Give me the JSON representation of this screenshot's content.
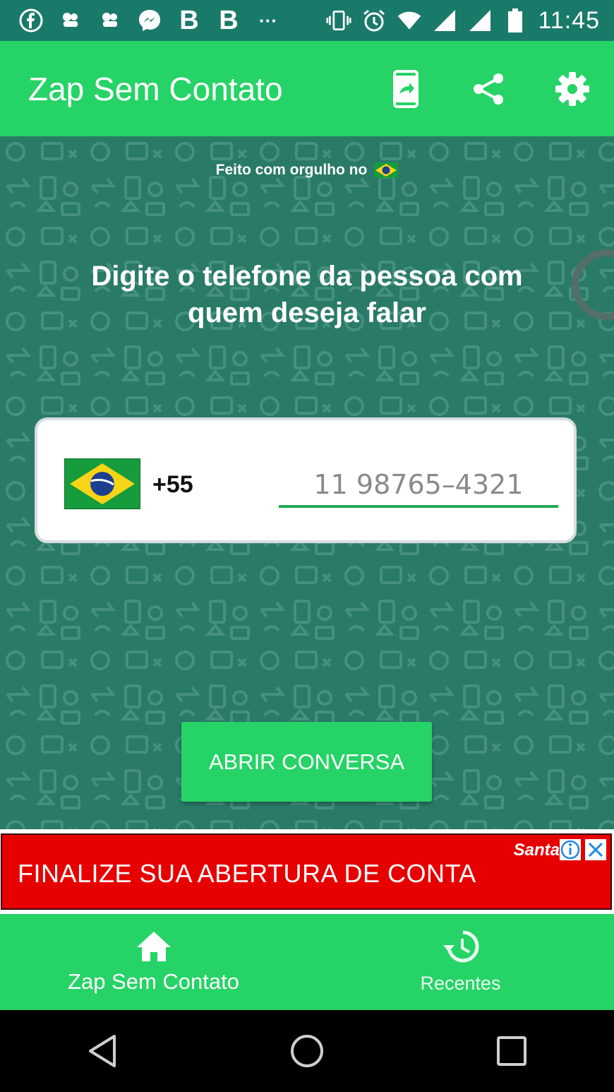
{
  "status_bar": {
    "time": "11:45",
    "icons": [
      "facebook-icon",
      "game-icon",
      "game-icon",
      "messenger-icon",
      "b-icon",
      "b-icon",
      "more-icon",
      "vibrate-icon",
      "alarm-icon",
      "wifi-icon",
      "signal-icon",
      "signal-icon",
      "battery-icon"
    ],
    "b_label": "B",
    "more_label": "···"
  },
  "app_bar": {
    "title": "Zap Sem Contato",
    "actions": [
      "open-in-app-icon",
      "share-icon",
      "settings-icon"
    ]
  },
  "main": {
    "tagline": "Feito com orgulho no",
    "headline": "Digite o telefone da pessoa com quem deseja falar",
    "country_code": "+55",
    "phone_placeholder": "11 98765–4321",
    "phone_value": "",
    "open_button_label": "ABRIR CONVERSA"
  },
  "ad": {
    "text": "FINALIZE SUA ABERTURA DE CONTA",
    "brand": "Santa"
  },
  "bottom_nav": {
    "items": [
      {
        "label": "Zap Sem Contato",
        "icon": "home-icon",
        "active": true
      },
      {
        "label": "Recentes",
        "icon": "history-icon",
        "active": false
      }
    ]
  },
  "colors": {
    "status_bar": "#1a7a6a",
    "app_bar": "#26d366",
    "background": "#2a7a68",
    "ad": "#e60000",
    "input_underline": "#1faa52"
  }
}
